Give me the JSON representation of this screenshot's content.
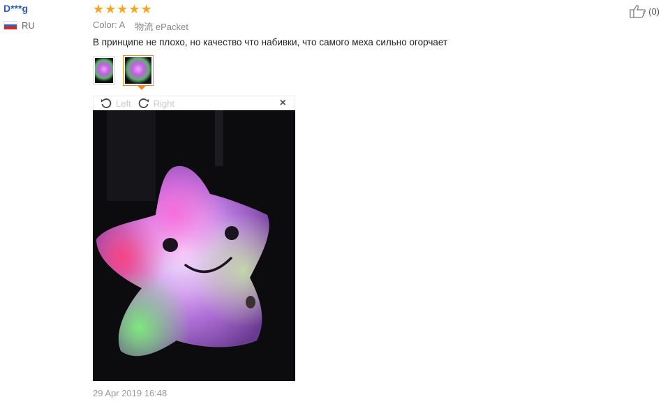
{
  "reviewer": {
    "name": "D***g",
    "country": "RU"
  },
  "rating": {
    "stars": 5,
    "max": 5
  },
  "meta": {
    "color_label": "Color:",
    "color_value": "A",
    "shipping_label": "物流",
    "shipping_value": "ePacket"
  },
  "review": {
    "text": "В принципе не плохо, но качество что набивки, что самого меха сильно огорчает"
  },
  "viewer": {
    "rotate_left": "Left",
    "rotate_right": "Right",
    "close_symbol": "×"
  },
  "date": "29 Apr 2019 16:48",
  "helpful": {
    "count": "(0)"
  },
  "colors": {
    "accent": "#f08a24",
    "star": "#f5a623",
    "name_link": "#2c5bbd"
  }
}
